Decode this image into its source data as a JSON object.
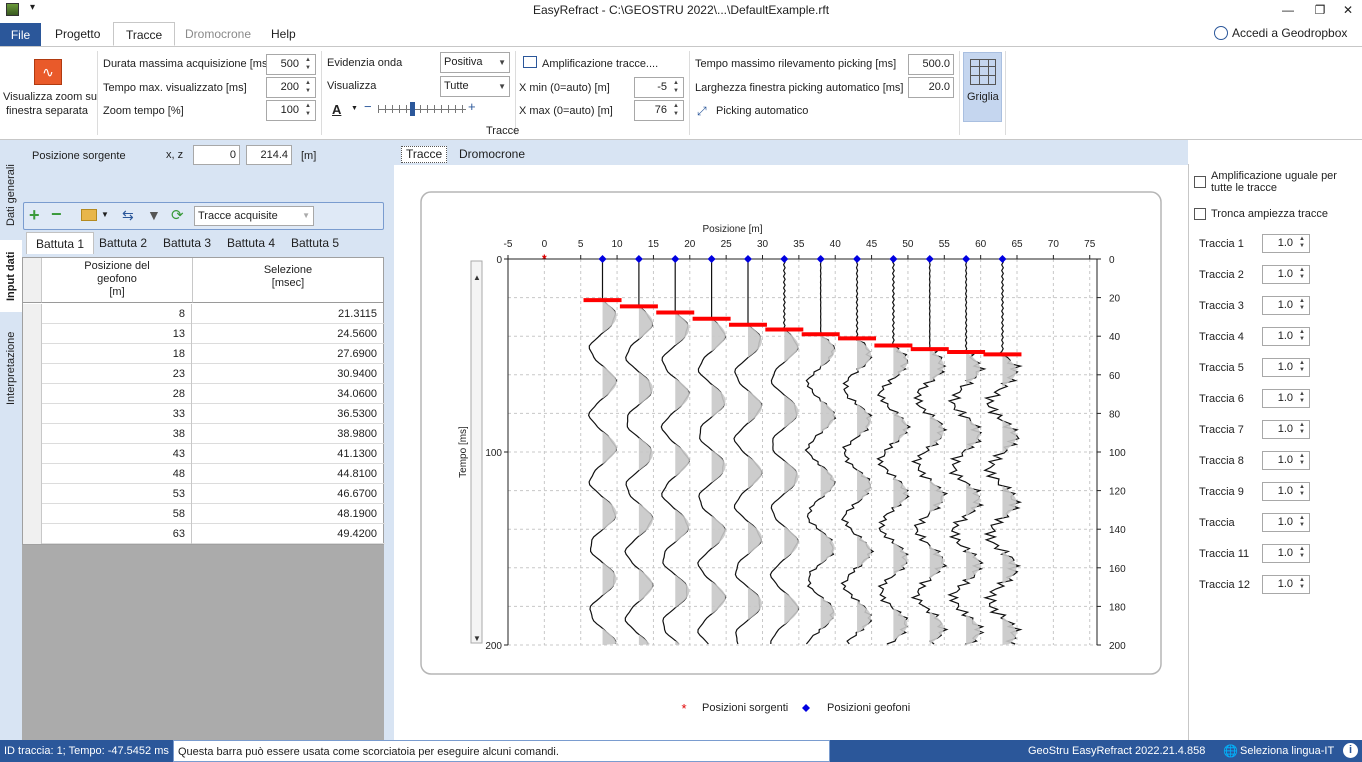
{
  "titlebar": {
    "title": "EasyRefract - C:\\GEOSTRU 2022\\...\\DefaultExample.rft"
  },
  "tabs": {
    "file": "File",
    "progetto": "Progetto",
    "tracce": "Tracce",
    "dromocrone": "Dromocrone",
    "help": "Help",
    "login": "Accedi a Geodropbox"
  },
  "ribbon": {
    "zoom_btn_line1": "Visualizza zoom su",
    "zoom_btn_line2": "finestra separata",
    "durata_label": "Durata massima acquisizione [ms]",
    "durata_value": "500",
    "tempo_vis_label": "Tempo max. visualizzato [ms]",
    "tempo_vis_value": "200",
    "zoom_tempo_label": "Zoom tempo [%]",
    "zoom_tempo_value": "100",
    "evidenzia_label": "Evidenzia onda",
    "evidenzia_value": "Positiva",
    "visualizza_label": "Visualizza",
    "visualizza_value": "Tutte",
    "ampl_label": "Amplificazione tracce....",
    "xmin_label": "X min (0=auto) [m]",
    "xmin_value": "-5",
    "xmax_label": "X max (0=auto) [m]",
    "xmax_value": "76",
    "tempo_pick_label": "Tempo massimo rilevamento picking [ms]",
    "tempo_pick_value": "500.0",
    "larghezza_label": "Larghezza finestra picking automatico [ms]",
    "larghezza_value": "20.0",
    "picking_auto_label": "Picking automatico",
    "griglia_label": "Griglia",
    "group_label": "Tracce"
  },
  "vtabs": {
    "dati": "Dati generali",
    "input": "Input dati",
    "interp": "Interpretazione"
  },
  "left": {
    "pos_label": "Posizione sorgente",
    "xz_label": "x, z",
    "x_value": "0",
    "z_value": "214.4",
    "unit": "[m]",
    "combo_value": "Tracce acquisite",
    "battute": [
      "Battuta 1",
      "Battuta 2",
      "Battuta 3",
      "Battuta 4",
      "Battuta 5"
    ],
    "col1_l1": "Posizione del",
    "col1_l2": "geofono",
    "col1_l3": "[m]",
    "col2_l1": "Selezione",
    "col2_l2": "[msec]",
    "rows": [
      {
        "pos": "8",
        "sel": "21.3115"
      },
      {
        "pos": "13",
        "sel": "24.5600"
      },
      {
        "pos": "18",
        "sel": "27.6900"
      },
      {
        "pos": "23",
        "sel": "30.9400"
      },
      {
        "pos": "28",
        "sel": "34.0600"
      },
      {
        "pos": "33",
        "sel": "36.5300"
      },
      {
        "pos": "38",
        "sel": "38.9800"
      },
      {
        "pos": "43",
        "sel": "41.1300"
      },
      {
        "pos": "48",
        "sel": "44.8100"
      },
      {
        "pos": "53",
        "sel": "46.6700"
      },
      {
        "pos": "58",
        "sel": "48.1900"
      },
      {
        "pos": "63",
        "sel": "49.4200"
      }
    ]
  },
  "center": {
    "tab_tracce": "Tracce",
    "tab_dromo": "Dromocrone"
  },
  "chart_data": {
    "type": "line",
    "xlabel": "Posizione [m]",
    "ylabel": "Tempo [ms]",
    "xlim": [
      -5,
      76
    ],
    "ylim": [
      0,
      200
    ],
    "x_ticks": [
      -5,
      0,
      5,
      10,
      15,
      20,
      25,
      30,
      35,
      40,
      45,
      50,
      55,
      60,
      65,
      70,
      75
    ],
    "y_ticks_left": [
      0,
      100,
      200
    ],
    "y_ticks_right": [
      0,
      20,
      40,
      60,
      80,
      100,
      120,
      140,
      160,
      180,
      200
    ],
    "grid": true,
    "legend_position": "bottom",
    "legend": [
      "Posizioni sorgenti",
      "Posizioni geofoni"
    ],
    "sources_x": [
      0
    ],
    "geophones_x": [
      8,
      13,
      18,
      23,
      28,
      33,
      38,
      43,
      48,
      53,
      58,
      63
    ],
    "picks_ms": [
      21.3115,
      24.56,
      27.69,
      30.94,
      34.06,
      36.53,
      38.98,
      41.13,
      44.81,
      46.67,
      48.19,
      49.42
    ],
    "colors": {
      "source": "#e00000",
      "geophone": "#0000e0",
      "pick": "#ff0000"
    }
  },
  "right": {
    "ampl_uguale_l1": "Amplificazione uguale per",
    "ampl_uguale_l2": "tutte le tracce",
    "tronca": "Tronca ampiezza tracce",
    "traces": [
      {
        "label": "Traccia  1",
        "value": "1.0"
      },
      {
        "label": "Traccia  2",
        "value": "1.0"
      },
      {
        "label": "Traccia  3",
        "value": "1.0"
      },
      {
        "label": "Traccia  4",
        "value": "1.0"
      },
      {
        "label": "Traccia  5",
        "value": "1.0"
      },
      {
        "label": "Traccia  6",
        "value": "1.0"
      },
      {
        "label": "Traccia  7",
        "value": "1.0"
      },
      {
        "label": "Traccia  8",
        "value": "1.0"
      },
      {
        "label": "Traccia  9",
        "value": "1.0"
      },
      {
        "label": "Traccia",
        "value": "1.0"
      },
      {
        "label": "Traccia 11",
        "value": "1.0"
      },
      {
        "label": "Traccia 12",
        "value": "1.0"
      }
    ]
  },
  "status": {
    "left": "ID traccia: 1; Tempo: -47.5452 ms",
    "msg": "Questa barra può essere usata come scorciatoia per eseguire alcuni comandi.",
    "version": "GeoStru EasyRefract 2022.21.4.858",
    "lang": "Seleziona lingua-IT"
  }
}
